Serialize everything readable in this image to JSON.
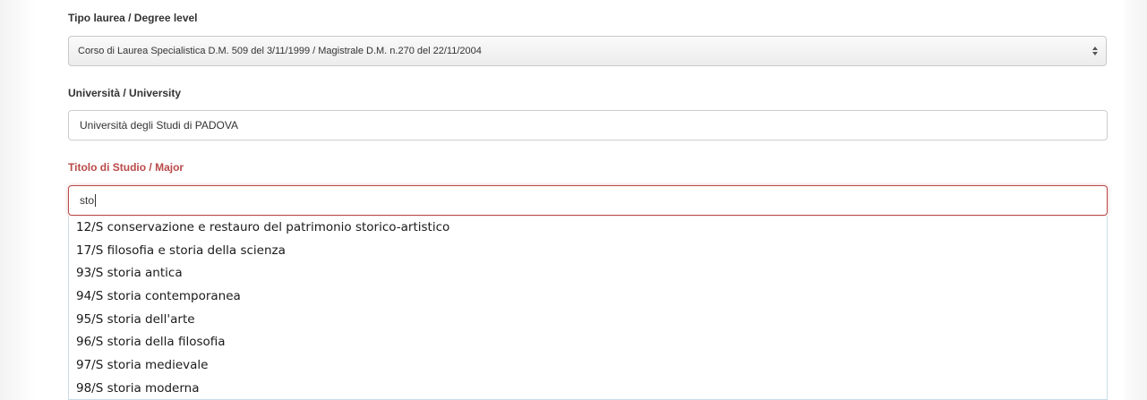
{
  "form": {
    "degree_level": {
      "label": "Tipo laurea / Degree level",
      "selected": "Corso di Laurea Specialistica D.M. 509 del 3/11/1999 / Magistrale D.M. n.270 del 22/11/2004"
    },
    "university": {
      "label": "Università / University",
      "value": "Università degli Studi di PADOVA"
    },
    "major": {
      "label": "Titolo di Studio / Major",
      "value": "sto"
    }
  },
  "autocomplete": {
    "items": [
      "12/S conservazione e restauro del patrimonio storico-artistico",
      "17/S filosofia e storia della scienza",
      "93/S storia antica",
      "94/S storia contemporanea",
      "95/S storia dell'arte",
      "96/S storia della filosofia",
      "97/S storia medievale",
      "98/S storia moderna"
    ]
  },
  "colors": {
    "error_red": "#b94a48",
    "label_dark": "#333333"
  }
}
